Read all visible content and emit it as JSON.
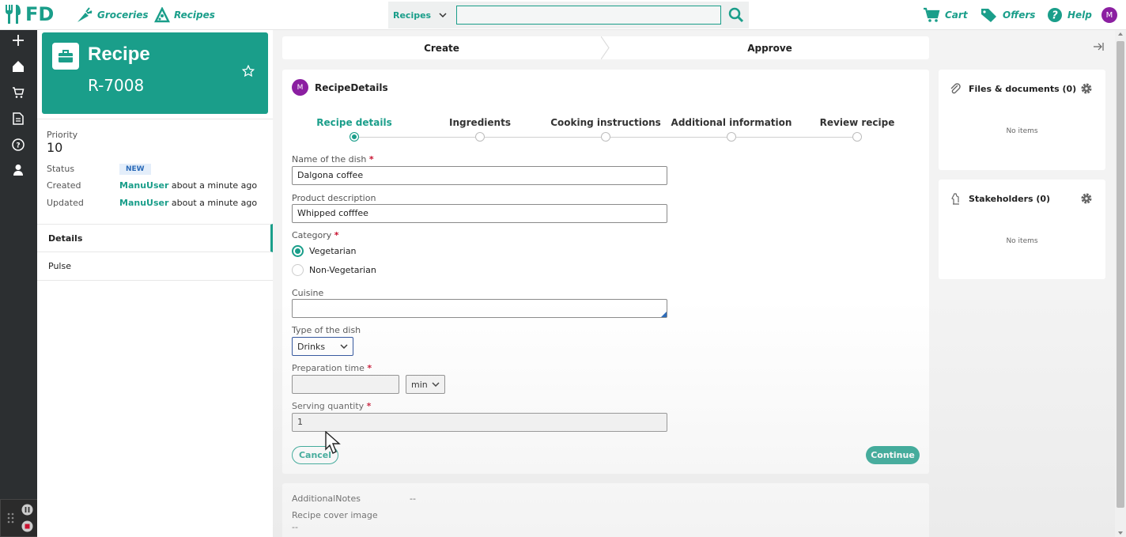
{
  "topbar": {
    "logo_text": "FD",
    "nav": [
      {
        "label": "Groceries"
      },
      {
        "label": "Recipes"
      }
    ],
    "search_scope": "Recipes",
    "search_value": "",
    "right": [
      {
        "label": "Cart"
      },
      {
        "label": "Offers"
      },
      {
        "label": "Help"
      }
    ],
    "avatar_initial": "M"
  },
  "case": {
    "type": "Recipe",
    "id": "R-7008",
    "priority_label": "Priority",
    "priority_value": "10",
    "status_label": "Status",
    "status_value": "NEW",
    "created_label": "Created",
    "created_user": "ManuUser",
    "created_time": "about a minute ago",
    "updated_label": "Updated",
    "updated_user": "ManuUser",
    "updated_time": "about a minute ago",
    "tabs": [
      {
        "label": "Details"
      },
      {
        "label": "Pulse"
      }
    ]
  },
  "stages": [
    {
      "label": "Create"
    },
    {
      "label": "Approve"
    }
  ],
  "form": {
    "avatar_initial": "M",
    "title": "RecipeDetails",
    "steps": [
      {
        "label": "Recipe details"
      },
      {
        "label": "Ingredients"
      },
      {
        "label": "Cooking instructions"
      },
      {
        "label": "Additional information"
      },
      {
        "label": "Review recipe"
      }
    ],
    "dish_name_label": "Name of the dish",
    "dish_name_value": "Dalgona coffee",
    "description_label": "Product description",
    "description_value": "Whipped cofffee",
    "category_label": "Category",
    "category_options": [
      {
        "label": "Vegetarian"
      },
      {
        "label": "Non-Vegetarian"
      }
    ],
    "cuisine_label": "Cuisine",
    "cuisine_value": "",
    "dish_type_label": "Type of the dish",
    "dish_type_value": "Drinks",
    "prep_time_label": "Preparation time",
    "prep_time_value": "",
    "prep_unit": "min",
    "serving_label": "Serving quantity",
    "serving_value": "1",
    "cancel_label": "Cancel",
    "continue_label": "Continue",
    "required_mark": "*"
  },
  "notes": {
    "additional_label": "AdditionalNotes",
    "additional_value": "--",
    "cover_label": "Recipe cover image",
    "cover_value": "--"
  },
  "right": {
    "files_title": "Files & documents (0)",
    "files_empty": "No items",
    "stake_title": "Stakeholders (0)",
    "stake_empty": "No items"
  },
  "colors": {
    "brand": "#1a9e8a",
    "avatar": "#8b1fa1",
    "required": "#c8102e"
  }
}
